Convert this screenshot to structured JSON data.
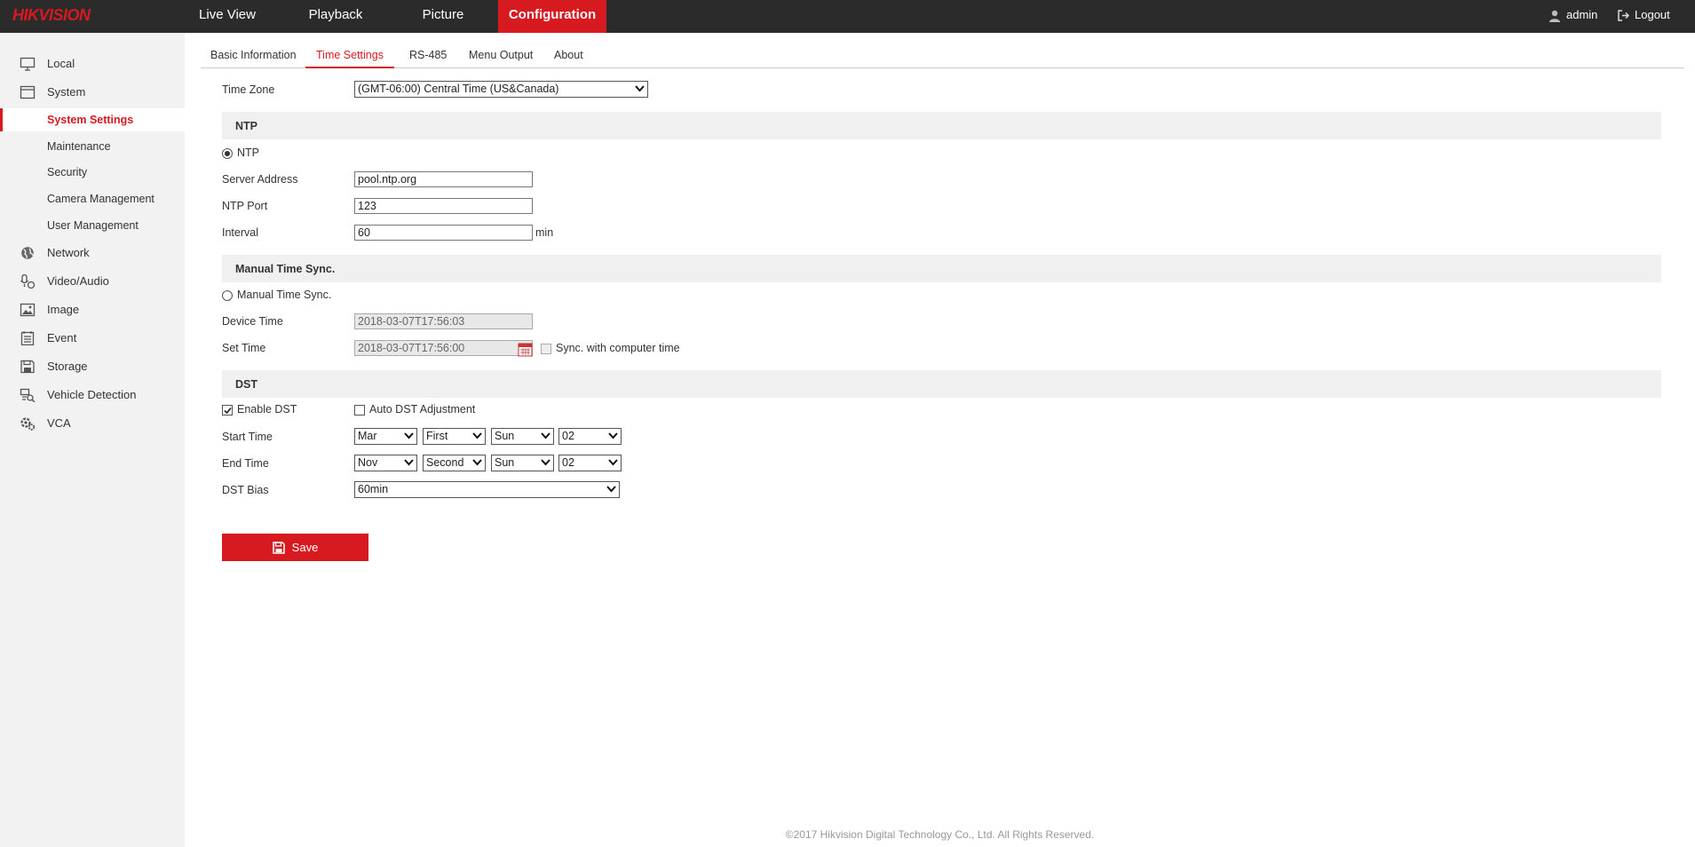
{
  "header": {
    "logo": "HIKVISION",
    "nav": [
      {
        "label": "Live View"
      },
      {
        "label": "Playback"
      },
      {
        "label": "Picture"
      },
      {
        "label": "Configuration"
      }
    ],
    "user": "admin",
    "logout": "Logout"
  },
  "sidebar": {
    "items": [
      {
        "label": "Local",
        "icon": "monitor-icon"
      },
      {
        "label": "System",
        "icon": "system-icon"
      },
      {
        "label": "System Settings"
      },
      {
        "label": "Maintenance"
      },
      {
        "label": "Security"
      },
      {
        "label": "Camera Management"
      },
      {
        "label": "User Management"
      },
      {
        "label": "Network",
        "icon": "globe-icon"
      },
      {
        "label": "Video/Audio",
        "icon": "mic-icon"
      },
      {
        "label": "Image",
        "icon": "image-icon"
      },
      {
        "label": "Event",
        "icon": "event-icon"
      },
      {
        "label": "Storage",
        "icon": "storage-icon"
      },
      {
        "label": "Vehicle Detection",
        "icon": "vehicle-detection-icon"
      },
      {
        "label": "VCA",
        "icon": "vca-icon"
      }
    ]
  },
  "tabs": [
    {
      "label": "Basic Information"
    },
    {
      "label": "Time Settings"
    },
    {
      "label": "RS-485"
    },
    {
      "label": "Menu Output"
    },
    {
      "label": "About"
    }
  ],
  "form": {
    "time_zone_label": "Time Zone",
    "time_zone_value": "(GMT-06:00) Central Time (US&Canada)",
    "ntp_section": "NTP",
    "ntp_radio": "NTP",
    "server_address_label": "Server Address",
    "server_address_value": "pool.ntp.org",
    "ntp_port_label": "NTP Port",
    "ntp_port_value": "123",
    "interval_label": "Interval",
    "interval_value": "60",
    "interval_unit": "min",
    "manual_section": "Manual Time Sync.",
    "manual_radio": "Manual Time Sync.",
    "device_time_label": "Device Time",
    "device_time_value": "2018-03-07T17:56:03",
    "set_time_label": "Set Time",
    "set_time_value": "2018-03-07T17:56:00",
    "sync_computer_label": "Sync. with computer time",
    "dst_section": "DST",
    "enable_dst_label": "Enable DST",
    "auto_dst_label": "Auto DST Adjustment",
    "start_time_label": "Start Time",
    "start_time": {
      "month": "Mar",
      "week": "First",
      "day": "Sun",
      "hour": "02"
    },
    "end_time_label": "End Time",
    "end_time": {
      "month": "Nov",
      "week": "Second",
      "day": "Sun",
      "hour": "02"
    },
    "dst_bias_label": "DST Bias",
    "dst_bias_value": "60min",
    "save_label": "Save"
  },
  "footer": "©2017 Hikvision Digital Technology Co., Ltd. All Rights Reserved."
}
